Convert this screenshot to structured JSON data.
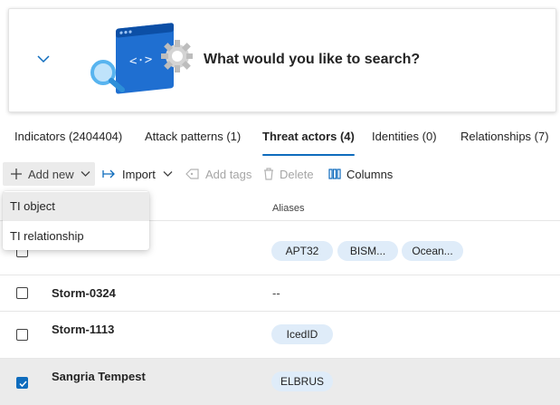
{
  "search": {
    "prompt": "What would you like to search?",
    "collapse_icon": "chevron-down-icon",
    "illustration": "search-code-gear-illustration"
  },
  "tabs": [
    {
      "label": "Indicators (2404404)",
      "active": false
    },
    {
      "label": "Attack patterns (1)",
      "active": false
    },
    {
      "label": "Threat actors (4)",
      "active": true
    },
    {
      "label": "Identities (0)",
      "active": false
    },
    {
      "label": "Relationships (7)",
      "active": false
    }
  ],
  "toolbar": {
    "add_new": "Add new",
    "import": "Import",
    "add_tags": "Add tags",
    "delete": "Delete",
    "columns": "Columns"
  },
  "add_menu": {
    "items": [
      "TI object",
      "TI relationship"
    ]
  },
  "table": {
    "columns": [
      "Aliases"
    ],
    "rows": [
      {
        "name": "",
        "aliases": [
          "APT32",
          "BISM...",
          "Ocean..."
        ],
        "checked": false,
        "selected": false
      },
      {
        "name": "Storm-0324",
        "aliases": [],
        "empty_alias": "--",
        "checked": false,
        "selected": false
      },
      {
        "name": "Storm-1113",
        "aliases": [
          "IcedID"
        ],
        "checked": false,
        "selected": false
      },
      {
        "name": "Sangria Tempest",
        "aliases": [
          "ELBRUS"
        ],
        "checked": true,
        "selected": true
      }
    ]
  },
  "colors": {
    "accent": "#0f6cbd",
    "pill": "#dfecf9",
    "selected_row": "#ebebeb"
  }
}
